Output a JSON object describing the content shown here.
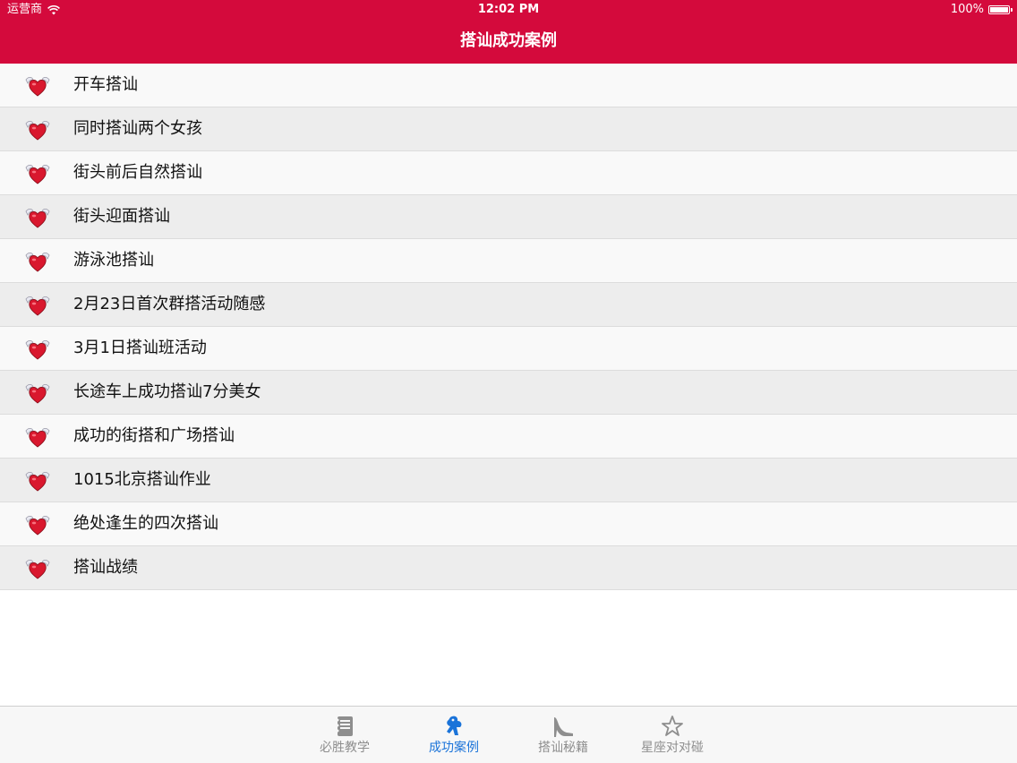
{
  "status_bar": {
    "carrier": "运营商",
    "time": "12:02 PM",
    "battery": "100%"
  },
  "nav": {
    "title": "搭讪成功案例"
  },
  "list": {
    "items": [
      {
        "label": "开车搭讪",
        "icon": "winged-heart-icon"
      },
      {
        "label": "同时搭讪两个女孩",
        "icon": "winged-heart-icon"
      },
      {
        "label": "街头前后自然搭讪",
        "icon": "winged-heart-icon"
      },
      {
        "label": "街头迎面搭讪",
        "icon": "winged-heart-icon"
      },
      {
        "label": "游泳池搭讪",
        "icon": "winged-heart-icon"
      },
      {
        "label": "2月23日首次群搭活动随感",
        "icon": "winged-heart-icon"
      },
      {
        "label": "3月1日搭讪班活动",
        "icon": "winged-heart-icon"
      },
      {
        "label": "长途车上成功搭讪7分美女",
        "icon": "winged-heart-icon"
      },
      {
        "label": "成功的街搭和广场搭讪",
        "icon": "winged-heart-icon"
      },
      {
        "label": "1015北京搭讪作业",
        "icon": "winged-heart-icon"
      },
      {
        "label": "绝处逢生的四次搭讪",
        "icon": "winged-heart-icon"
      },
      {
        "label": "搭讪战绩",
        "icon": "winged-heart-icon"
      }
    ]
  },
  "tabbar": {
    "tabs": [
      {
        "label": "必胜教学",
        "icon": "notebook-icon",
        "active": false
      },
      {
        "label": "成功案例",
        "icon": "cupid-icon",
        "active": true
      },
      {
        "label": "搭讪秘籍",
        "icon": "high-heel-icon",
        "active": false
      },
      {
        "label": "星座对对碰",
        "icon": "star-icon",
        "active": false
      }
    ]
  },
  "colors": {
    "brand_red": "#d40a3c",
    "active_tab": "#1a73d9",
    "inactive_tab": "#8e8e8e"
  }
}
